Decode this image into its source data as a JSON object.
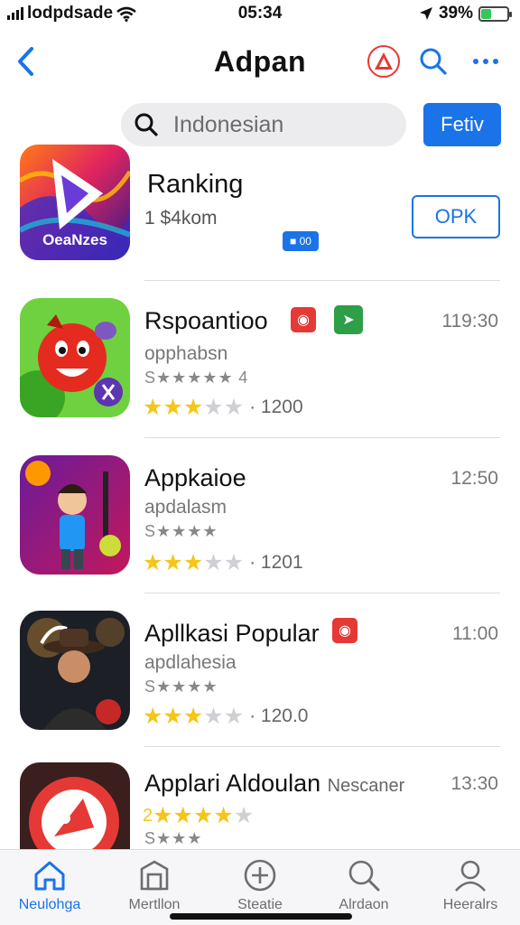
{
  "status": {
    "carrier": "lodpdsade",
    "time": "05:34",
    "battery": "39%",
    "battery_level": 0.39
  },
  "nav": {
    "title": "Adpan"
  },
  "search": {
    "value": "Indonesian",
    "filter_label": "Fetiv"
  },
  "featured": {
    "title": "Ranking",
    "subtitle": "1 $4kom",
    "icon_caption": "OeaNzes",
    "chip": "■ 00",
    "button_label": "OPK"
  },
  "apps": [
    {
      "name": "Rspoantioo",
      "developer": "opphabsn",
      "stars_text": "S★★★★★ 4",
      "rating": 3.5,
      "rating_count": "· 1200",
      "time": "119:30"
    },
    {
      "name": "Appkaioe",
      "developer": "apdalasm",
      "stars_text": "S★★★★",
      "rating": 3.5,
      "rating_count": "· 1201",
      "time": "12:50"
    },
    {
      "name": "Apllkasi Popular",
      "developer": "apdlahesia",
      "stars_text": "S★★★★",
      "rating": 3.5,
      "rating_count": "· 120.0",
      "time": "11:00"
    },
    {
      "name": "Applari Aldoulan",
      "name_suffix": "Nescaner",
      "stars_prefix": "2",
      "developer": "S★★★",
      "rating": 4.5,
      "time": "13:30"
    }
  ],
  "tabs": [
    {
      "label": "Neulohga",
      "icon": "home-icon"
    },
    {
      "label": "Mertllon",
      "icon": "store-icon"
    },
    {
      "label": "Steatie",
      "icon": "plus-circle-icon"
    },
    {
      "label": "Alrdaon",
      "icon": "search-icon"
    },
    {
      "label": "Heeralrs",
      "icon": "person-icon"
    }
  ],
  "colors": {
    "accent": "#1a73e8",
    "star": "#f5c518",
    "battery": "#34c759",
    "badge_red": "#e53935",
    "badge_green": "#2e9e48"
  }
}
